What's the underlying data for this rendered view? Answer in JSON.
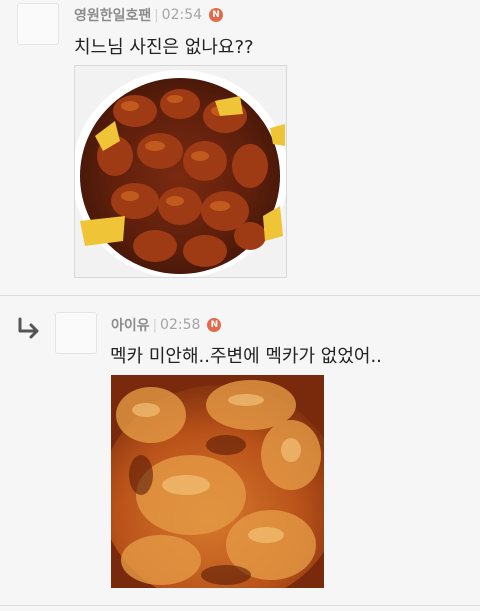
{
  "comments": [
    {
      "author": "영원한일호팬",
      "time": "02:54",
      "badge": "N",
      "text": "치느님 사진은 없나요??",
      "photo_icon": "sweet-sour-chicken-photo",
      "is_reply": false
    },
    {
      "author": "아이유",
      "time": "02:58",
      "badge": "N",
      "text": "멕카 미안해..주변에 멕카가 없었어..",
      "photo_icon": "fried-chicken-photo",
      "is_reply": true,
      "reply_icon": "reply-arrow-icon"
    }
  ],
  "colors": {
    "background": "#f6f6f6",
    "badge": "#e46a4d",
    "author": "#8c8c8c",
    "divider": "#dcdcdc"
  }
}
